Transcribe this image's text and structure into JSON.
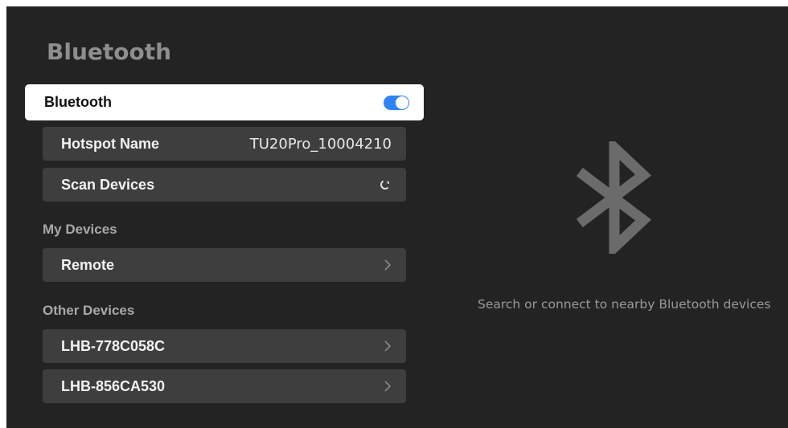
{
  "header": {
    "title": "Bluetooth"
  },
  "bluetooth_toggle": {
    "label": "Bluetooth",
    "state": "on",
    "accent_color": "#2f83f6"
  },
  "hotspot": {
    "label": "Hotspot Name",
    "value": "TU20Pro_10004210"
  },
  "scan": {
    "label": "Scan Devices",
    "status_icon": "loading-spinner-icon"
  },
  "my_devices": {
    "section_label": "My Devices",
    "items": [
      {
        "label": "Remote"
      }
    ]
  },
  "other_devices": {
    "section_label": "Other Devices",
    "items": [
      {
        "label": "LHB-778C058C"
      },
      {
        "label": "LHB-856CA530"
      }
    ]
  },
  "right_panel": {
    "icon": "bluetooth-icon",
    "hint": "Search or connect to nearby Bluetooth devices"
  }
}
